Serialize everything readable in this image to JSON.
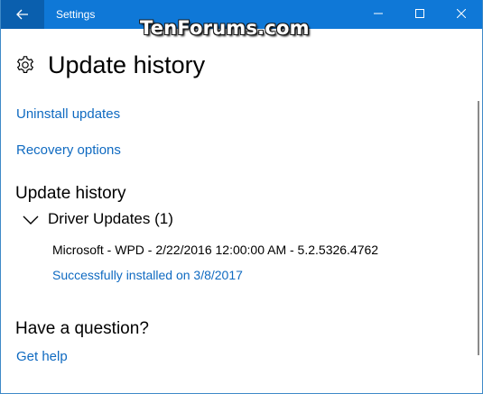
{
  "titlebar": {
    "back_icon": "arrow-left-icon",
    "app_title": "Settings",
    "watermark": "TenForums.com",
    "minimize_icon": "minimize-icon",
    "maximize_icon": "maximize-icon",
    "close_icon": "close-icon",
    "color": "#0f78d7"
  },
  "page": {
    "icon": "gear-icon",
    "title": "Update history"
  },
  "links": {
    "uninstall": "Uninstall updates",
    "recovery": "Recovery options"
  },
  "history": {
    "title": "Update history",
    "groups": [
      {
        "label": "Driver Updates (1)",
        "expanded": true,
        "items": [
          {
            "name": "Microsoft - WPD - 2/22/2016 12:00:00 AM - 5.2.5326.4762",
            "status": "Successfully installed on 3/8/2017"
          }
        ]
      }
    ]
  },
  "question": {
    "title": "Have a question?",
    "help_link": "Get help"
  },
  "colors": {
    "accent": "#0f6ac1",
    "titlebar": "#0f78d7"
  }
}
